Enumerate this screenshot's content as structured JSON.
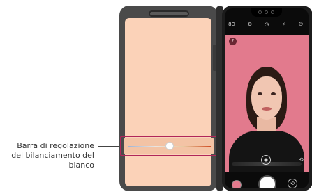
{
  "callout": {
    "line1": "Barra di regolazione",
    "line2": "del bilanciamento del",
    "line3": "bianco"
  },
  "white_balance": {
    "level": 0.5,
    "colors": {
      "cool": "#9fb3d3",
      "neutral": "#ebe5e0",
      "warm": "#d04a20"
    }
  },
  "camera_top_icons": [
    {
      "icon": "hdr-icon",
      "text": "8D"
    },
    {
      "icon": "settings-icon",
      "text": "⚙"
    },
    {
      "icon": "timer-icon",
      "text": "◷"
    },
    {
      "icon": "flash-icon",
      "text": "⚡"
    },
    {
      "icon": "power-icon",
      "text": "⏻"
    }
  ],
  "preview": {
    "help_icon": "?",
    "portrait_icon": "◉",
    "switch_icon": "⟲"
  },
  "colors": {
    "left_screen": "#fbd2b8",
    "highlight": "#b0265a",
    "background": "#e27a8d"
  }
}
